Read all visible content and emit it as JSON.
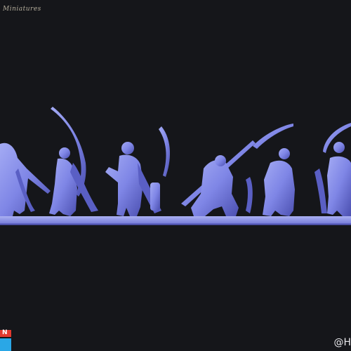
{
  "image": {
    "logo_text": "Miniatures",
    "watermark": "@H",
    "brand_letter": "N",
    "colors": {
      "background": "#15161a",
      "figure": "#7f86e6",
      "figure_shadow": "#4b4fb0",
      "base_strip": "#8e95e8",
      "brand_red": "#e23a2e",
      "brand_blue": "#2aa7e6"
    },
    "figures": [
      "elf-archer-1",
      "elf-archer-2",
      "elf-archer-3",
      "elf-archer-4",
      "elf-archer-5",
      "elf-archer-6"
    ]
  }
}
